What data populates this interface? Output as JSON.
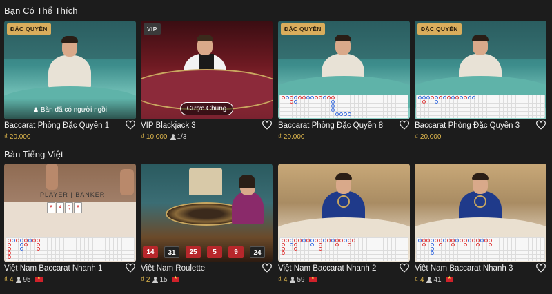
{
  "sections": [
    {
      "title": "Bạn Có Thể Thích",
      "cards": [
        {
          "name": "Baccarat Phòng Đặc Quyền 1",
          "badge": "ĐẶC QUYỀN",
          "overlay": "Bàn đã có người ngồi",
          "price": "₫ 20.000"
        },
        {
          "name": "VIP Blackjack 3",
          "badge": "VIP",
          "overlay": "Cược Chung",
          "price": "₫ 10.000",
          "players": "1/3"
        },
        {
          "name": "Baccarat Phòng Đặc Quyền 8",
          "badge": "ĐẶC QUYỀN",
          "price": "₫ 20.000"
        },
        {
          "name": "Baccarat Phòng Đặc Quyền 3",
          "badge": "ĐẶC QUYỀN",
          "price": "₫ 20.000"
        }
      ]
    },
    {
      "title": "Bàn Tiếng Việt",
      "cards": [
        {
          "name": "Việt Nam Baccarat Nhanh 1",
          "price": "₫ 4",
          "players": "95",
          "table_text": "PLAYER | BANKER"
        },
        {
          "name": "Việt Nam Roulette",
          "price": "₫ 2",
          "players": "15",
          "results": [
            "14",
            "31",
            "25",
            "5",
            "9",
            "24"
          ]
        },
        {
          "name": "Việt Nam Baccarat Nhanh 2",
          "price": "₫ 4",
          "players": "59"
        },
        {
          "name": "Việt Nam Baccarat Nhanh 3",
          "price": "₫ 4",
          "players": "41"
        }
      ]
    }
  ],
  "colors": {
    "accent": "#d9ad5c",
    "price": "#e0b84d",
    "background": "#1c1c1c",
    "banker": "#e03b3b",
    "player": "#3a6de0"
  },
  "icons": [
    "heart-icon",
    "person-icon",
    "vietnam-flag-icon",
    "person-seated-icon"
  ]
}
